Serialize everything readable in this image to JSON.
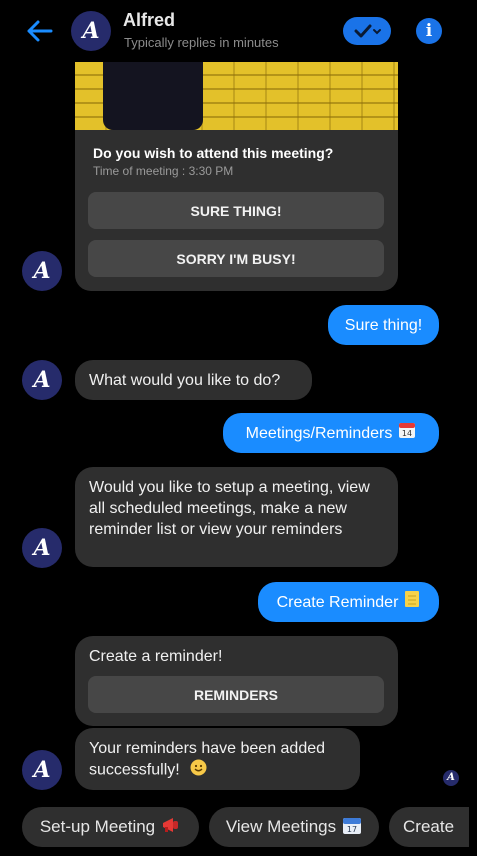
{
  "header": {
    "name": "Alfred",
    "subtitle": "Typically replies in minutes",
    "avatar_letter": "A"
  },
  "card": {
    "title": "Do you wish to attend this meeting?",
    "subtitle": "Time of meeting : 3:30 PM",
    "buttons": [
      "SURE THING!",
      "SORRY I'M BUSY!"
    ]
  },
  "messages": {
    "out_1": "Sure thing!",
    "in_1": "What would you like to do?",
    "out_2": "Meetings/Reminders",
    "in_2": "Would you like to setup a meeting, view all scheduled meetings, make a new reminder list or view your reminders",
    "out_3": "Create Reminder",
    "in_3_title": "Create a reminder!",
    "in_3_button": "REMINDERS",
    "in_4": "Your reminders have been added successfully!"
  },
  "calendar_day": "14",
  "calendar_day_2": "17",
  "quick_replies": [
    "Set-up Meeting",
    "View Meetings",
    "Create"
  ],
  "colors": {
    "accent": "#1a8cff",
    "bubble_in": "#2f2f2f",
    "background": "#000000"
  }
}
